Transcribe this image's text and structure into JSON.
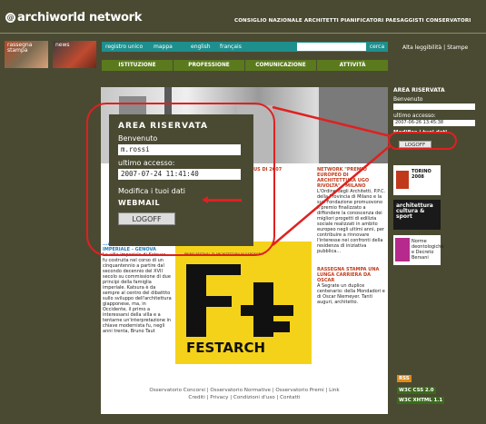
{
  "header": {
    "logo_text": "archiworld network",
    "council": "CONSIGLIO NAZIONALE ARCHITETTI PIANIFICATORI PAESAGGISTI CONSERVATORI"
  },
  "thumbs": {
    "rassegna": "rassegna stampa",
    "news": "news"
  },
  "nav": {
    "registro": "registro unico",
    "mappa": "mappa",
    "english": "english",
    "francais": "français",
    "search_placeholder": "",
    "search_button": "cerca",
    "alta": "Alta leggibilità",
    "stampa": "Stampe"
  },
  "tabs": [
    "ISTITUZIONE",
    "PROFESSIONE",
    "COMUNICAZIONE",
    "ATTIVITÀ"
  ],
  "sidebar": {
    "title": "AREA RISERVATA",
    "benvenuto": "Benvenuto",
    "ultimo": "ultimo accesso:",
    "date_small": "2007-06-26 13:45:38",
    "modifica": "Modifica i tuoi dati",
    "logoff": "LOGOFF",
    "banner_torino": "TORINO 2008",
    "banner_arch": "architettura cultura & sport",
    "banner_norme": "Norme deontologiche e Decreto Bersani",
    "rss": "RSS",
    "w3c_css": "W3C CSS 2.0",
    "w3c_xhtml": "W3C XHTML 1.1"
  },
  "zoom": {
    "title": "AREA RISERVATA",
    "benvenuto": "Benvenuto",
    "user": "m.rossi",
    "ultimo": "ultimo accesso:",
    "date": "2007-07-24 11:41:40",
    "modifica": "Modifica i tuoi dati",
    "webmail": "WEBMAIL",
    "logoff": "LOGOFF"
  },
  "content": {
    "left_title": "...ATURA CA VILLA IMPERIALE - GENOVA",
    "left_text": "La villa imperiale di Katsura fu costruita nel corso di un cinquantennio a partire dal secondo decennio del XVII secolo su commissione di due principi della famiglia imperiale. Katsura è da sempre al centro del dibattito sullo sviluppo dell'architettura giapponese, ma, in Occidente, il primo a interessarsi della villa e a tentarne un'interpretazione in chiave modernista fu, negli anni trenta, Bruno Taut",
    "mid_title": "IL FOCUS DI 2007",
    "mid_text": "... ... ...",
    "right_title": "NETWORK \"PREMIO EUROPEO DI ARCHITETTURA UGO RIVOLTA\" - MILANO",
    "right_text": "L'Ordine degli Architetti, P.P.C. della Provincia di Milano e la sua Fondazione promuovono il premio finalizzato a diffondere la conoscenza dei migliori progetti di edilizia sociale realizzati in ambito europeo negli ultimi anni, per contribuire a rinnovare l'interesse nei confronti della residenza di iniziativa pubblica...",
    "rassegna_title": "RASSEGNA STAMPA UNA LUNGA CARRIERA DA OSCAR",
    "rassegna_text": "A Segrate un duplice centenario: della Mondadori e di Oscar Niemeyer. Tanti auguri, architetto.",
    "festarch_sub": "PRIMO FESTIVAL DI ARCHITETTURA IN SARDEGNA",
    "festarch": "FESTARCH"
  },
  "footer": {
    "line1": "Osservatorio Concorsi | Osservatorio Normative | Osservatorio Premi | Link",
    "line2": "Crediti | Privacy | Condizioni d'uso | Contatti"
  },
  "colors": {
    "bg": "#4a4a32",
    "nav": "#1e8f8d",
    "tabs": "#5b7a1e",
    "highlight": "#e02020",
    "festarch": "#f5d21a"
  }
}
